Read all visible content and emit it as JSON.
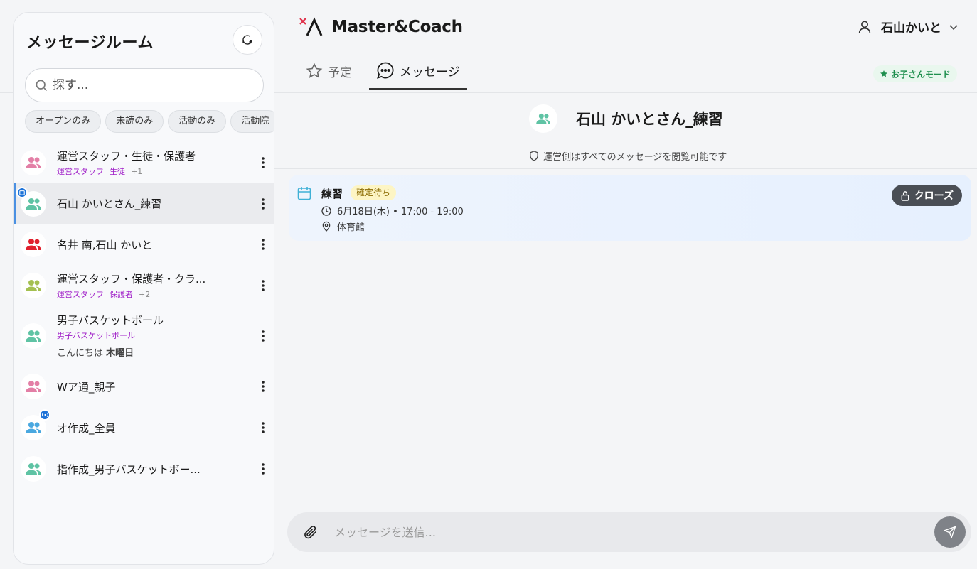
{
  "sidebar": {
    "title": "メッセージルーム",
    "search_placeholder": "探す...",
    "filters": [
      "オープンのみ",
      "未読のみ",
      "活動のみ",
      "活動院"
    ],
    "rooms": [
      {
        "name": "運営スタッフ・生徒・保護者",
        "tags": [
          "運営スタッフ",
          "生徒"
        ],
        "more": "+1",
        "avatar_color": "#e37fa6"
      },
      {
        "name": "石山 かいとさん_練習",
        "avatar_color": "#5fc3a4",
        "active": true
      },
      {
        "name": "名井 南,石山 かいと",
        "avatar_color": "#e0202d"
      },
      {
        "name": "運営スタッフ・保護者・クラ...",
        "tags": [
          "運営スタッフ",
          "保護者"
        ],
        "more": "+2",
        "avatar_color": "#a4c050"
      },
      {
        "name": "男子バスケットボール",
        "tags": [
          "男子バスケットボール"
        ],
        "preview_text": "こんにちは",
        "preview_day": "木曜日",
        "avatar_color": "#5fc3a4"
      },
      {
        "name": "Wア通_親子",
        "avatar_color": "#e37fa6"
      },
      {
        "name": "オ作成_全員",
        "avatar_color": "#4aa8e0"
      },
      {
        "name": "指作成_男子バスケットボー...",
        "avatar_color": "#5fc3a4"
      }
    ]
  },
  "header": {
    "brand": "Master&Coach",
    "user_name": "石山かいと",
    "tabs": [
      "予定",
      "メッセージ"
    ],
    "mode_badge": "お子さんモード"
  },
  "room": {
    "title": "石山 かいとさん_練習",
    "notice": "運営側はすべてのメッセージを閲覧可能です"
  },
  "event": {
    "title": "練習",
    "status": "確定待ち",
    "datetime": "6月18日(木) • 17:00 - 19:00",
    "location": "体育館",
    "close_label": "クローズ"
  },
  "composer": {
    "placeholder": "メッセージを送信..."
  },
  "colors": {
    "accent": "#4a90e2",
    "tag": "#a020c8",
    "mode_green": "#1f8f4e",
    "status_yellow": "#fdf5c4"
  }
}
